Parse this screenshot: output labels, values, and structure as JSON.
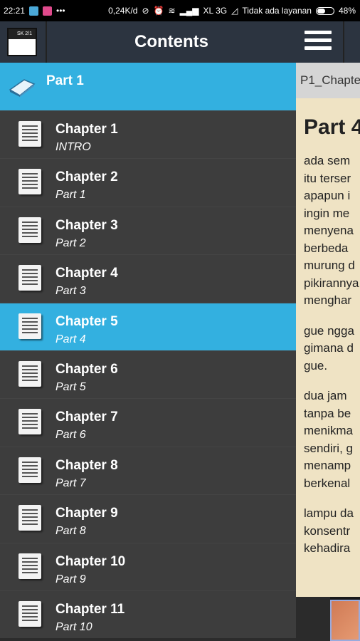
{
  "status": {
    "time": "22:21",
    "speed": "0,24K/d",
    "network": "XL 3G",
    "service": "Tidak ada layanan",
    "battery": "48%"
  },
  "drawer": {
    "app_icon_text": "SK 2/1",
    "title": "Contents",
    "part": "Part 1",
    "selected_index": 4,
    "chapters": [
      {
        "title": "Chapter 1",
        "subtitle": "INTRO"
      },
      {
        "title": "Chapter 2",
        "subtitle": "Part 1"
      },
      {
        "title": "Chapter 3",
        "subtitle": "Part 2"
      },
      {
        "title": "Chapter 4",
        "subtitle": "Part 3"
      },
      {
        "title": "Chapter 5",
        "subtitle": "Part 4"
      },
      {
        "title": "Chapter 6",
        "subtitle": "Part 5"
      },
      {
        "title": "Chapter 7",
        "subtitle": "Part 6"
      },
      {
        "title": "Chapter 8",
        "subtitle": "Part 7"
      },
      {
        "title": "Chapter 9",
        "subtitle": "Part 8"
      },
      {
        "title": "Chapter 10",
        "subtitle": "Part 9"
      },
      {
        "title": "Chapter 11",
        "subtitle": "Part 10"
      }
    ]
  },
  "reader": {
    "breadcrumb": "P1_Chapte",
    "heading": "Part 4",
    "paragraphs": [
      "ada sem\nitu terser\napapun i\ningin me\nmenyena\nberbeda\nmurung d\npikirannya\nmenghar",
      "gue ngga\ngimana d\ngue.",
      "dua jam\ntanpa be\nmenikma\nsendiri, g\nmenamp\nberkenal",
      "lampu da\nkonsentr\nkehadira"
    ]
  },
  "colors": {
    "header": "#2c3440",
    "accent": "#33b0e0",
    "list_bg": "#3d3d3d",
    "page_bg": "#efe3c4"
  }
}
